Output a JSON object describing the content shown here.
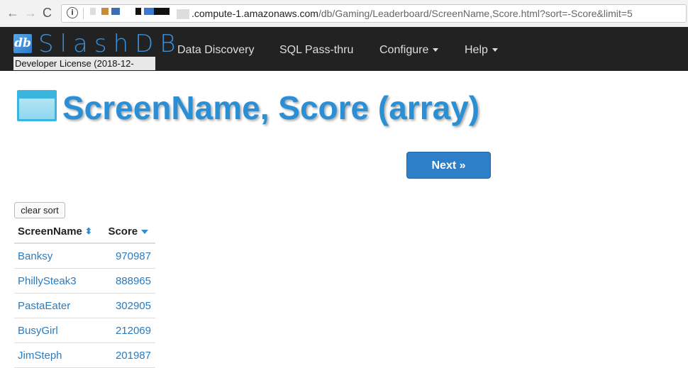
{
  "browser": {
    "back_glyph": "←",
    "forward_glyph": "→",
    "reload_glyph": "C",
    "info_glyph": "i",
    "url_host": ".compute-1.amazonaws.com",
    "url_path": "/db/Gaming/Leaderboard/ScreenName,Score.html?sort=-Score&limit=5"
  },
  "app": {
    "logo_mark": "db",
    "logo_text": "SlashDB",
    "license": "Developer License (2018-12-",
    "nav": [
      {
        "label": "Data Discovery"
      },
      {
        "label": "SQL Pass-thru"
      },
      {
        "label": "Configure"
      },
      {
        "label": "Help"
      }
    ]
  },
  "page": {
    "title": "ScreenName, Score (array)",
    "next_label": "Next »",
    "clear_sort_label": "clear sort"
  },
  "table": {
    "headers": [
      "ScreenName",
      "Score"
    ],
    "rows": [
      [
        "Banksy",
        "970987"
      ],
      [
        "PhillySteak3",
        "888965"
      ],
      [
        "PastaEater",
        "302905"
      ],
      [
        "BusyGirl",
        "212069"
      ],
      [
        "JimSteph",
        "201987"
      ]
    ]
  },
  "colors": {
    "accent": "#2a8fd4",
    "navbar": "#222222",
    "button": "#2d7fc8"
  },
  "icons": {
    "back": "arrow-left-icon",
    "forward": "arrow-right-icon",
    "reload": "reload-icon",
    "info": "info-icon",
    "table": "table-icon",
    "sort_both": "sort-both-icon",
    "sort_desc": "sort-desc-icon"
  }
}
